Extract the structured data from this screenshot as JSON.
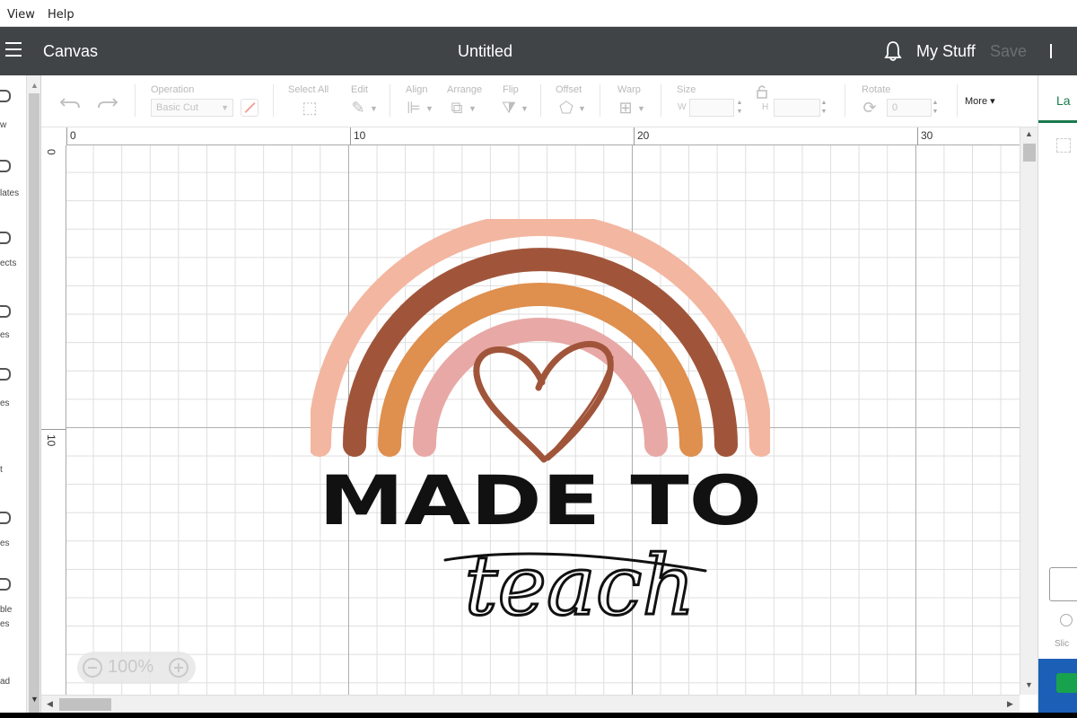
{
  "menubar": {
    "items": [
      "View",
      "Help"
    ]
  },
  "header": {
    "app_title": "Canvas",
    "document_title": "Untitled",
    "my_stuff": "My Stuff",
    "save": "Save"
  },
  "left_sidebar": {
    "items": [
      "w",
      "lates",
      "ects",
      "es",
      "es",
      "t",
      "es",
      "ble es",
      "ad"
    ]
  },
  "toolbar": {
    "operation_label": "Operation",
    "operation_value": "Basic Cut",
    "select_all": "Select All",
    "edit": "Edit",
    "align": "Align",
    "arrange": "Arrange",
    "flip": "Flip",
    "offset": "Offset",
    "warp": "Warp",
    "size": "Size",
    "size_w": "W",
    "size_h": "H",
    "rotate": "Rotate",
    "rotate_value": "0",
    "more": "More"
  },
  "right_panel": {
    "tab": "La",
    "slice": "Slic"
  },
  "canvas": {
    "ruler_x": [
      "0",
      "10",
      "20",
      "30"
    ],
    "ruler_y": [
      "0",
      "10"
    ],
    "zoom": "100%"
  },
  "design": {
    "line1": "MADE TO",
    "line2": "teach"
  },
  "colors": {
    "header_bg": "#404447",
    "accent_green": "#1a7a4c",
    "rainbow_outer": "#f3b6a1",
    "rainbow_second": "#a0553a",
    "rainbow_third": "#df8f4e",
    "rainbow_inner": "#e8a9a6"
  }
}
